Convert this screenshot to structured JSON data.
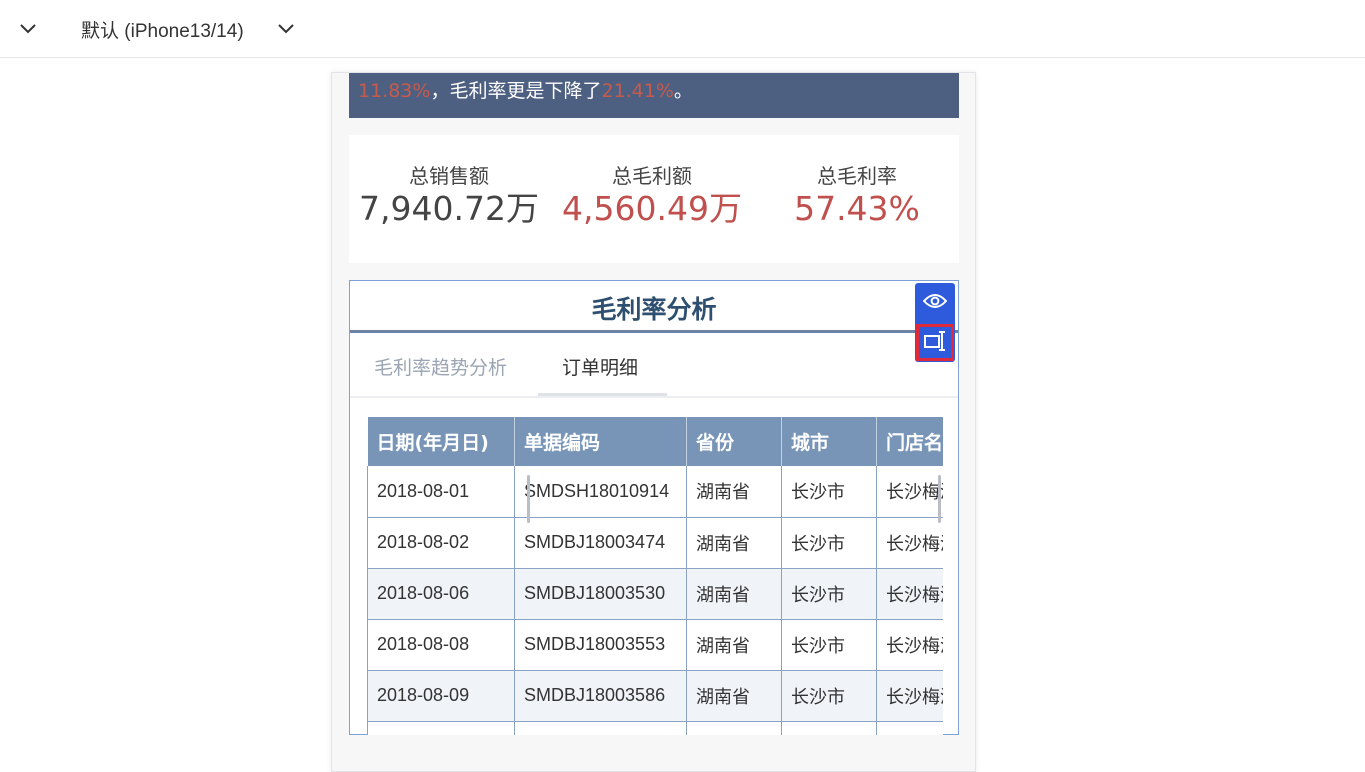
{
  "topbar": {
    "device_label": "默认 (iPhone13/14)"
  },
  "summary_banner": {
    "pct_a": "11.83%",
    "mid_text": "，毛利率更是下降了",
    "pct_b": "21.41%",
    "end_text": "。"
  },
  "kpis": [
    {
      "label": "总销售额",
      "value": "7,940.72万",
      "color": "#444444"
    },
    {
      "label": "总毛利额",
      "value": "4,560.49万",
      "color": "#c0504d"
    },
    {
      "label": "总毛利率",
      "value": "57.43%",
      "color": "#c0504d"
    }
  ],
  "widget": {
    "title": "毛利率分析",
    "tabs": [
      "毛利率趋势分析",
      "订单明细"
    ],
    "active_tab": "订单明细"
  },
  "table": {
    "columns": [
      "日期(年月日)",
      "单据编码",
      "省份",
      "城市",
      "门店名称"
    ],
    "rows": [
      [
        "2018-08-01",
        "SMDSH18010914",
        "湖南省",
        "长沙市",
        "长沙梅溪湖店"
      ],
      [
        "2018-08-02",
        "SMDBJ18003474",
        "湖南省",
        "长沙市",
        "长沙梅溪湖店"
      ],
      [
        "2018-08-06",
        "SMDBJ18003530",
        "湖南省",
        "长沙市",
        "长沙梅溪湖店"
      ],
      [
        "2018-08-08",
        "SMDBJ18003553",
        "湖南省",
        "长沙市",
        "长沙梅溪湖店"
      ],
      [
        "2018-08-09",
        "SMDBJ18003586",
        "湖南省",
        "长沙市",
        "长沙梅溪湖店"
      ],
      [
        "",
        "",
        "",
        "",
        ""
      ]
    ]
  },
  "colors": {
    "accent": "#2e5bdc",
    "highlight_border": "#e02a3b",
    "header_bg": "#7895b8",
    "banner_bg": "#4e6082"
  },
  "icons": {
    "left_chevron": "chevron-down-icon",
    "right_chevron": "chevron-down-icon",
    "preview": "eye-icon",
    "resize": "resize-icon"
  }
}
